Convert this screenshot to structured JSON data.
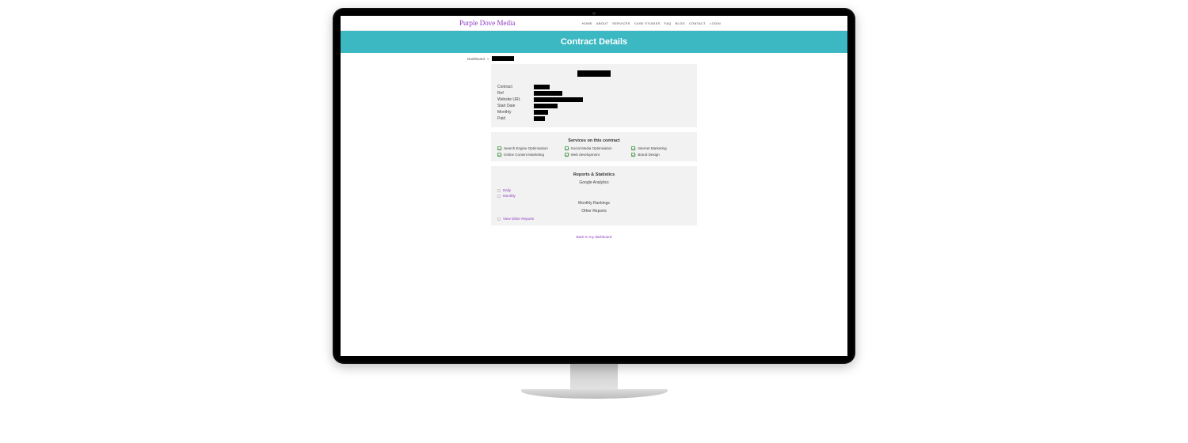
{
  "brand": "Purple Dove Media",
  "nav": [
    "HOME",
    "ABOUT",
    "SERVICES",
    "CASE STUDIES",
    "FAQ",
    "BLOG",
    "CONTACT",
    "LOGIN"
  ],
  "banner_title": "Contract Details",
  "breadcrumb": {
    "root": "Dashboard",
    "sep": "»"
  },
  "details": {
    "labels": {
      "contract": "Contract",
      "ref": "Ref",
      "website": "Website URL",
      "start": "Start Date",
      "monthly": "Monthly",
      "paid": "Paid"
    }
  },
  "services": {
    "title": "Services on this contract",
    "items": [
      "Search Engine Optimisation",
      "Social Media Optimisation",
      "Internet Marketing",
      "Online Content Marketing",
      "Web development",
      "Brand Design"
    ]
  },
  "reports": {
    "title": "Reports & Statistics",
    "ga": "Google Analytics",
    "periods": [
      "Daily",
      "Monthly"
    ],
    "monthly_rankings": "Monthly Rankings",
    "other_reports": "Other Reports",
    "view_other": "View Other Reports"
  },
  "backlink": "Back to my dashboard"
}
